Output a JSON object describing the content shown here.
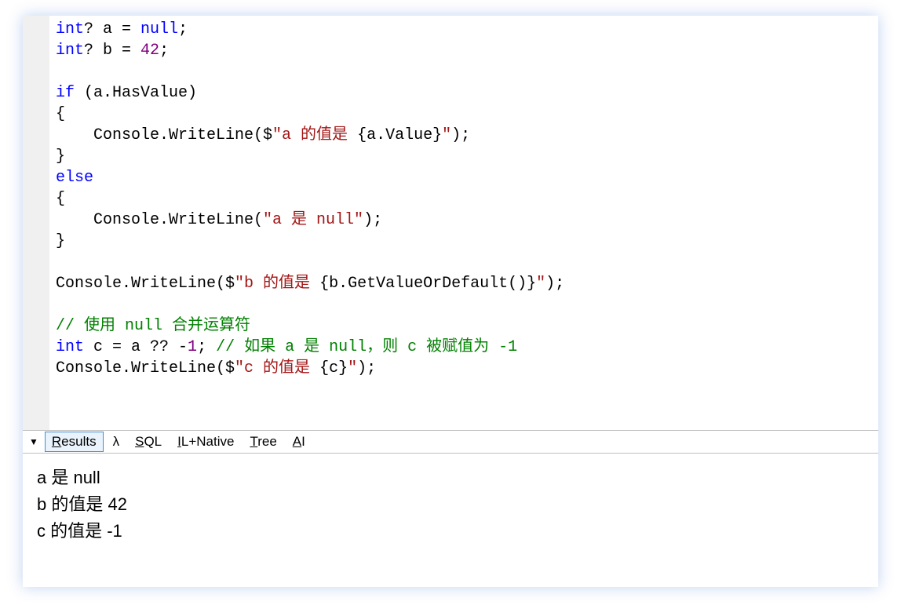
{
  "code": {
    "line1": {
      "kw": "int",
      "q": "?",
      "sp": " a = ",
      "lit": "null",
      "end": ";"
    },
    "line2": {
      "kw": "int",
      "q": "?",
      "sp": " b = ",
      "num": "42",
      "end": ";"
    },
    "line4": {
      "kw": "if",
      "cond": " (a.HasValue)"
    },
    "line5": {
      "brace": "{"
    },
    "line6": {
      "indent": "    Console.WriteLine($",
      "str1": "\"a 的值是 ",
      "interp_open": "{",
      "expr": "a.Value",
      "interp_close": "}",
      "str2": "\"",
      "end": ");"
    },
    "line7": {
      "brace": "}"
    },
    "line8": {
      "kw": "else"
    },
    "line9": {
      "brace": "{"
    },
    "line10": {
      "indent": "    Console.WriteLine(",
      "str": "\"a 是 null\"",
      "end": ");"
    },
    "line11": {
      "brace": "}"
    },
    "line13": {
      "pre": "Console.WriteLine($",
      "str1": "\"b 的值是 ",
      "interp_open": "{",
      "expr": "b.GetValueOrDefault()",
      "interp_close": "}",
      "str2": "\"",
      "end": ");"
    },
    "line15": {
      "cmt": "// 使用 null 合并运算符"
    },
    "line16": {
      "kw": "int",
      "mid": " c = a ?? -",
      "num": "1",
      "semi": "; ",
      "cmt": "// 如果 a 是 null，则 c 被赋值为 -1"
    },
    "line17": {
      "pre": "Console.WriteLine($",
      "str1": "\"c 的值是 ",
      "interp_open": "{",
      "expr": "c",
      "interp_close": "}",
      "str2": "\"",
      "end": ");"
    }
  },
  "tabs": {
    "results": {
      "u": "R",
      "rest": "esults"
    },
    "lambda": "λ",
    "sql": {
      "u": "S",
      "rest": "QL"
    },
    "ilnative": {
      "u": "I",
      "rest": "L+Native"
    },
    "tree": {
      "u": "T",
      "rest": "ree"
    },
    "ai": {
      "u": "A",
      "rest": "I"
    }
  },
  "output": {
    "line1": "a 是 null",
    "line2": "b 的值是 42",
    "line3": "c 的值是 -1"
  }
}
